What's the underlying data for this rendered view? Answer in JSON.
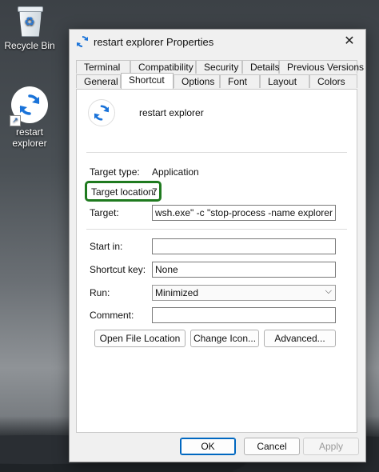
{
  "desktop": {
    "icons": [
      {
        "label": "Recycle Bin",
        "icon": "recycle-bin-icon"
      },
      {
        "label": "restart explorer",
        "icon": "refresh-shortcut-icon"
      }
    ]
  },
  "dialog": {
    "title": "restart explorer Properties",
    "close_glyph": "✕",
    "tabs_row1": [
      "Terminal",
      "Compatibility",
      "Security",
      "Details",
      "Previous Versions"
    ],
    "tabs_row2": [
      "General",
      "Shortcut",
      "Options",
      "Font",
      "Layout",
      "Colors"
    ],
    "active_tab": "Shortcut",
    "shortcut_name": "restart explorer",
    "target_type_label": "Target type:",
    "target_type_value": "Application",
    "target_location_label": "Target location:",
    "target_location_value": "7",
    "target_label": "Target:",
    "target_value": "wsh.exe\" -c \"stop-process -name explorer -force\"",
    "start_in_label": "Start in:",
    "start_in_value": "",
    "shortcut_key_label": "Shortcut key:",
    "shortcut_key_value": "None",
    "run_label": "Run:",
    "run_value": "Minimized",
    "comment_label": "Comment:",
    "comment_value": "",
    "buttons": {
      "open_file_location": "Open File Location",
      "change_icon": "Change Icon...",
      "advanced": "Advanced..."
    },
    "footer": {
      "ok": "OK",
      "cancel": "Cancel",
      "apply": "Apply"
    }
  },
  "colors": {
    "highlight": "#1f7a1f",
    "accent": "#0067c0"
  }
}
